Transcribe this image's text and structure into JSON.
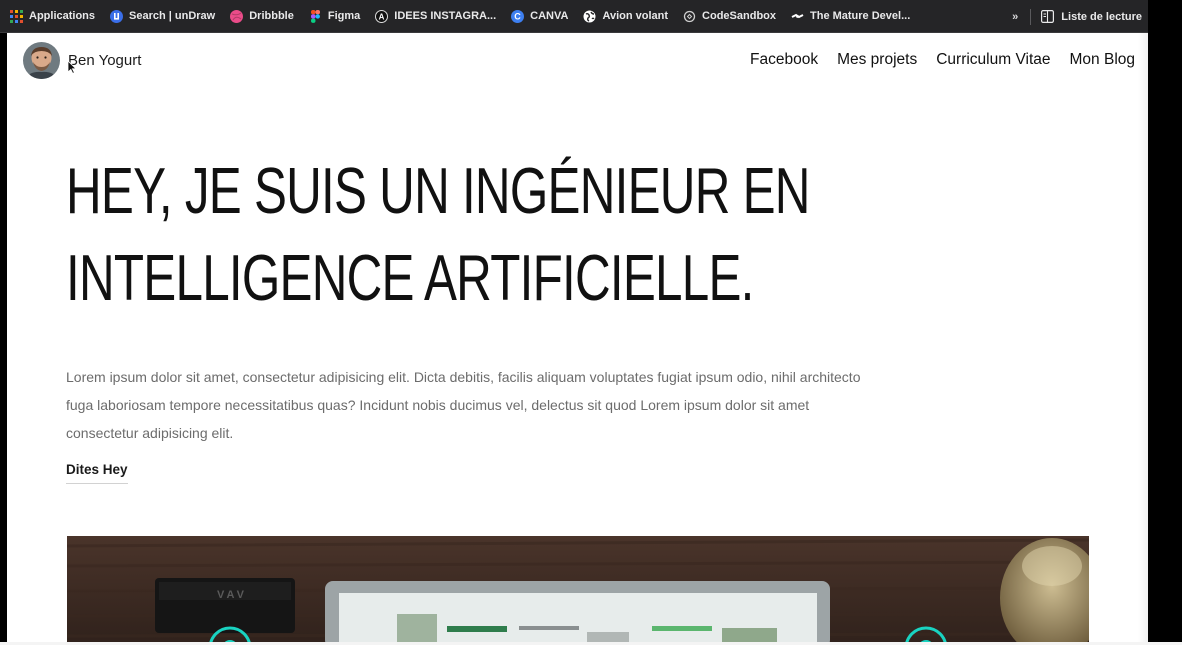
{
  "bookmarks": {
    "items": [
      {
        "label": "Applications",
        "icon": "apps-grid-icon",
        "color": "#e2502f"
      },
      {
        "label": "Search | unDraw",
        "icon": "undraw-icon",
        "color": "#3a6ee8"
      },
      {
        "label": "Dribbble",
        "icon": "dribbble-icon",
        "color": "#ea4c89"
      },
      {
        "label": "Figma",
        "icon": "figma-icon",
        "color": "#f24e1e"
      },
      {
        "label": "IDEES INSTAGRA...",
        "icon": "instagram-idea-icon",
        "color": "#dcdcdc"
      },
      {
        "label": "CANVA",
        "icon": "canva-icon",
        "color": "#3d7ff0"
      },
      {
        "label": "Avion volant",
        "icon": "globe-icon",
        "color": "#ffffff"
      },
      {
        "label": "CodeSandbox",
        "icon": "codesandbox-icon",
        "color": "#cfcfcf"
      },
      {
        "label": "The Mature Devel...",
        "icon": "mature-dev-icon",
        "color": "#ffffff"
      }
    ],
    "overflow": "»",
    "reading_list": "Liste de lecture"
  },
  "header": {
    "brand_name": "Ben Yogurt",
    "nav": [
      "Facebook",
      "Mes projets",
      "Curriculum Vitae",
      "Mon Blog"
    ]
  },
  "hero": {
    "title_line1": "HEY, JE SUIS UN INGÉNIEUR EN",
    "title_line2": "INTELLIGENCE ARTIFICIELLE.",
    "paragraph": "Lorem ipsum dolor sit amet, consectetur adipisicing elit. Dicta debitis, facilis aliquam voluptates fugiat ipsum odio, nihil architecto fuga laboriosam tempore necessitatibus quas? Incidunt nobis ducimus vel, delectus sit quod Lorem ipsum dolor sit amet consectetur adipisicing elit.",
    "cta": "Dites Hey"
  },
  "colors": {
    "toolbar_bg": "#252527",
    "page_bg": "#ffffff",
    "title": "#111111",
    "body_text": "#6c6c6c",
    "teal_accent": "#19d3c1"
  }
}
